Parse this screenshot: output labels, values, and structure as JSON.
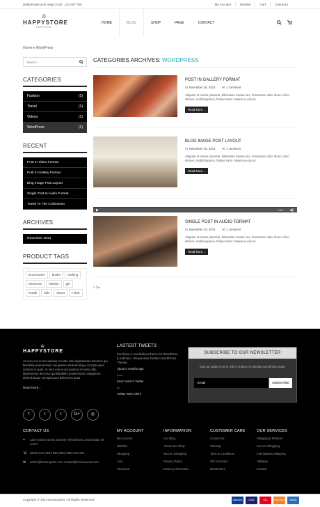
{
  "topbar": {
    "welcome": "Default welcome msg! | Call : 124 457 756",
    "links": [
      "My Account",
      "Wishlist",
      "Cart",
      "Checkout"
    ]
  },
  "logo": {
    "crown": "♔",
    "name": "HAPPYSTORE",
    "sub": "FASHION"
  },
  "nav": [
    "HOME",
    "BLOG",
    "SHOP",
    "PAGE",
    "CONTACT"
  ],
  "breadcrumb": "Home ▸ WordPress",
  "sidebar": {
    "search_placeholder": "Search...",
    "categories_title": "CATEGORIES",
    "categories": [
      {
        "name": "Fashion",
        "count": "(1)"
      },
      {
        "name": "Travel",
        "count": "(1)"
      },
      {
        "name": "Videos",
        "count": "(1)"
      },
      {
        "name": "WordPress",
        "count": "(1)"
      }
    ],
    "recent_title": "RECENT",
    "recent": [
      "Post In Video Format",
      "Post In Gallery Format",
      "Blog Image Post Layout",
      "Single Post In Audio Format",
      "Travel To The Colosseum"
    ],
    "archives_title": "ARCHIVES",
    "archive": "November 2014",
    "tags_title": "PRODUCT TAGS",
    "tags": [
      "accessories",
      "books",
      "clothing",
      "electronic",
      "fashion",
      "girl",
      "health",
      "kids",
      "shoes",
      "t-shirt"
    ]
  },
  "main": {
    "title_prefix": "CATEGORIES ARCHIVES: ",
    "title_hl": "WORDPRESS",
    "posts": [
      {
        "title": "POST IN GALLERY FORMAT",
        "date": "November 26, 2014",
        "comments": "1 comment",
        "excerpt": "Aliquam et metus pharetra, bibendum massa nec, fermentum odio. Nunc id leo ultrices, mollis ligula in, finibus tortor. Mauris eu dui ut",
        "readmore": "Read More..."
      },
      {
        "title": "BLOG IMAGE POST LAYOUT",
        "date": "November 25, 2014",
        "comments": "1 comment",
        "excerpt": "Aliquam et metus pharetra, bibendum massa nec, fermentum odio. Nunc id leo ultrices, mollis ligula in, finibus tortor. Mauris eu dui ut",
        "readmore": "Read More..."
      },
      {
        "title": "SINGLE POST IN AUDIO FORMAT",
        "date": "November 24, 2014",
        "comments": "1 comment",
        "excerpt": "Aliquam et metus pharetra, bibendum massa nec, fermentum odio. Nunc id leo ultrices, mollis ligula in, finibus tortor. Mauris eu dui ut",
        "readmore": "Read More..."
      }
    ],
    "audio": {
      "time": "1:56",
      "play": "▶",
      "vol": "◀)"
    },
    "pagination": "1 2 ▸"
  },
  "footer": {
    "logo_name": "HAPPYSTORE",
    "about": "At vero eos et accusamus et iusto odio dignissimos ducimus qui blanditiis praesentium voluptatum deleniti atque corrupti quos dolores et quas. At vero eos et accusamus et iusto odio dignissimos ducimus qui blanditiis praesentium voluptatum deleniti atque corrupti quos dolores et quas",
    "readmore": "Read more...",
    "tweets_title": "LASTEST TWEETS",
    "tweet_text": "Purchase a new fashion theme for WordPress (LookCare - Responsive Fashion WordPress Theme)",
    "tweet_when": "About 3 months ago",
    "tweet_from": "from",
    "tweet_author": "Kevin Sobo's Twitter",
    "tweet_on": "on",
    "tweet_web": "Twitter Web Client",
    "newsletter_title": "SUBSCRIBE TO OUR NEWSLETTER",
    "newsletter_sub": "Sign up today to be in with a chance of winning something magic",
    "email_placeholder": "Email",
    "subscribe": "SUBSCRIBE",
    "social": [
      "f",
      "t",
      "t",
      "G+",
      "◎"
    ],
    "contact_title": "CONTACT US",
    "contact_addr": "120 Heaven Street, Beverly Hill OldYork United State Of Lorem",
    "contact_phone": "(800) 0123 4567 890 (800) 0987 654 321",
    "contact_email": "admin@bootexperts.com contact@bootexperts.com",
    "cols": [
      {
        "title": "MY ACCOUNT",
        "items": [
          "My Account",
          "Wishlist",
          "Shopping",
          "Cart",
          "Checkout"
        ]
      },
      {
        "title": "INFORMATION",
        "items": [
          "Our Blog",
          "About Our Shop",
          "Secure Shopping",
          "Privacy Policy",
          "Delivery infomation"
        ]
      },
      {
        "title": "CUSTOMER CARE",
        "items": [
          "Contact us",
          "Sitemap",
          "Term & Conditions",
          "Gift Vouchers",
          "BestSellers"
        ]
      },
      {
        "title": "OUR SERVICES",
        "items": [
          "Shipping & Returns",
          "Secure Shopping",
          "International Shipping",
          "Affiliates",
          "Contact"
        ]
      }
    ],
    "copyright": "Copyright © 2014 Bootexperts. All Rights Reserved",
    "payments": [
      "Maestro",
      "VISA",
      "MC",
      "DISCOVER",
      "BANK"
    ]
  },
  "colors": {
    "accent": "#22aabb",
    "dark": "#000000"
  }
}
